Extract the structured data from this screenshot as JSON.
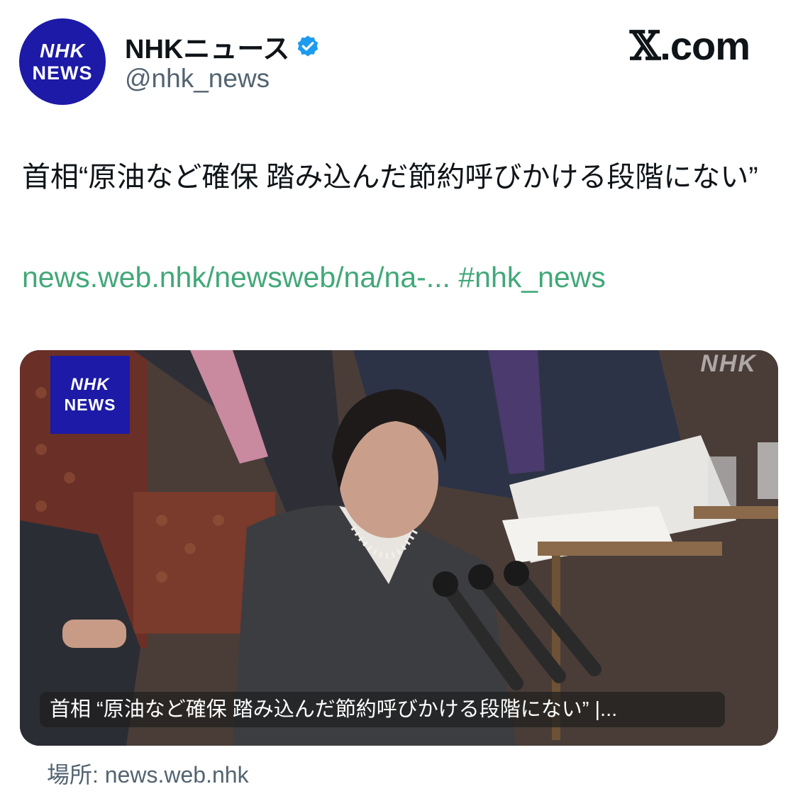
{
  "author": {
    "avatar_line1": "NHK",
    "avatar_line2": "NEWS",
    "display_name": "NHKニュース",
    "handle": "@nhk_news",
    "verified_color": "#1d9bf0"
  },
  "brand": {
    "x": "𝕏",
    "suffix": ".com"
  },
  "tweet": {
    "text": "首相“原油など確保 踏み込んだ節約呼びかける段階にない”",
    "link": "news.web.nhk/newsweb/na/na-...",
    "hashtag": "#nhk_news",
    "link_color": "#41a878"
  },
  "card": {
    "logo_line1": "NHK",
    "logo_line2": "NEWS",
    "watermark": "NHK",
    "caption": "首相 “原油など確保 踏み込んだ節約呼びかける段階にない” |..."
  },
  "source": "場所: news.web.nhk"
}
